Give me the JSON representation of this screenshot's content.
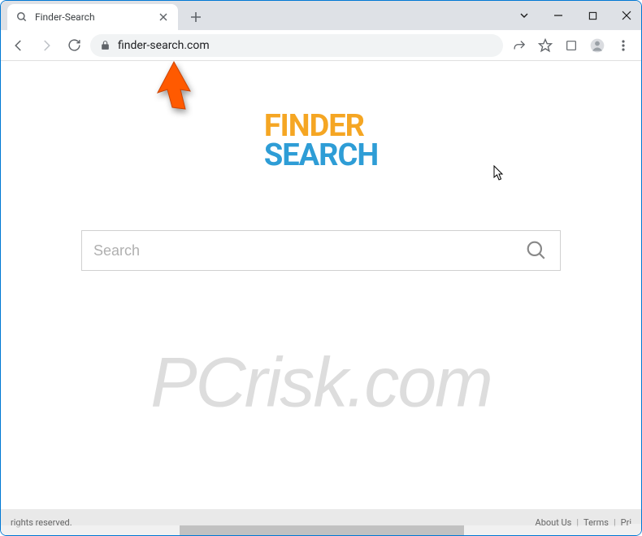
{
  "window": {
    "tab_title": "Finder-Search"
  },
  "address_bar": {
    "url": "finder-search.com"
  },
  "page": {
    "logo_line1": "FINDER",
    "logo_line2": "SEARCH",
    "search_placeholder": "Search"
  },
  "footer": {
    "left_text": "rights reserved.",
    "link_about": "About Us",
    "link_terms": "Terms",
    "link_privacy": "Pri"
  },
  "watermark": {
    "text": "PCrisk.com"
  },
  "colors": {
    "accent_orange": "#f5a623",
    "accent_blue": "#2e9dd6",
    "arrow_orange": "#ff5a00"
  }
}
